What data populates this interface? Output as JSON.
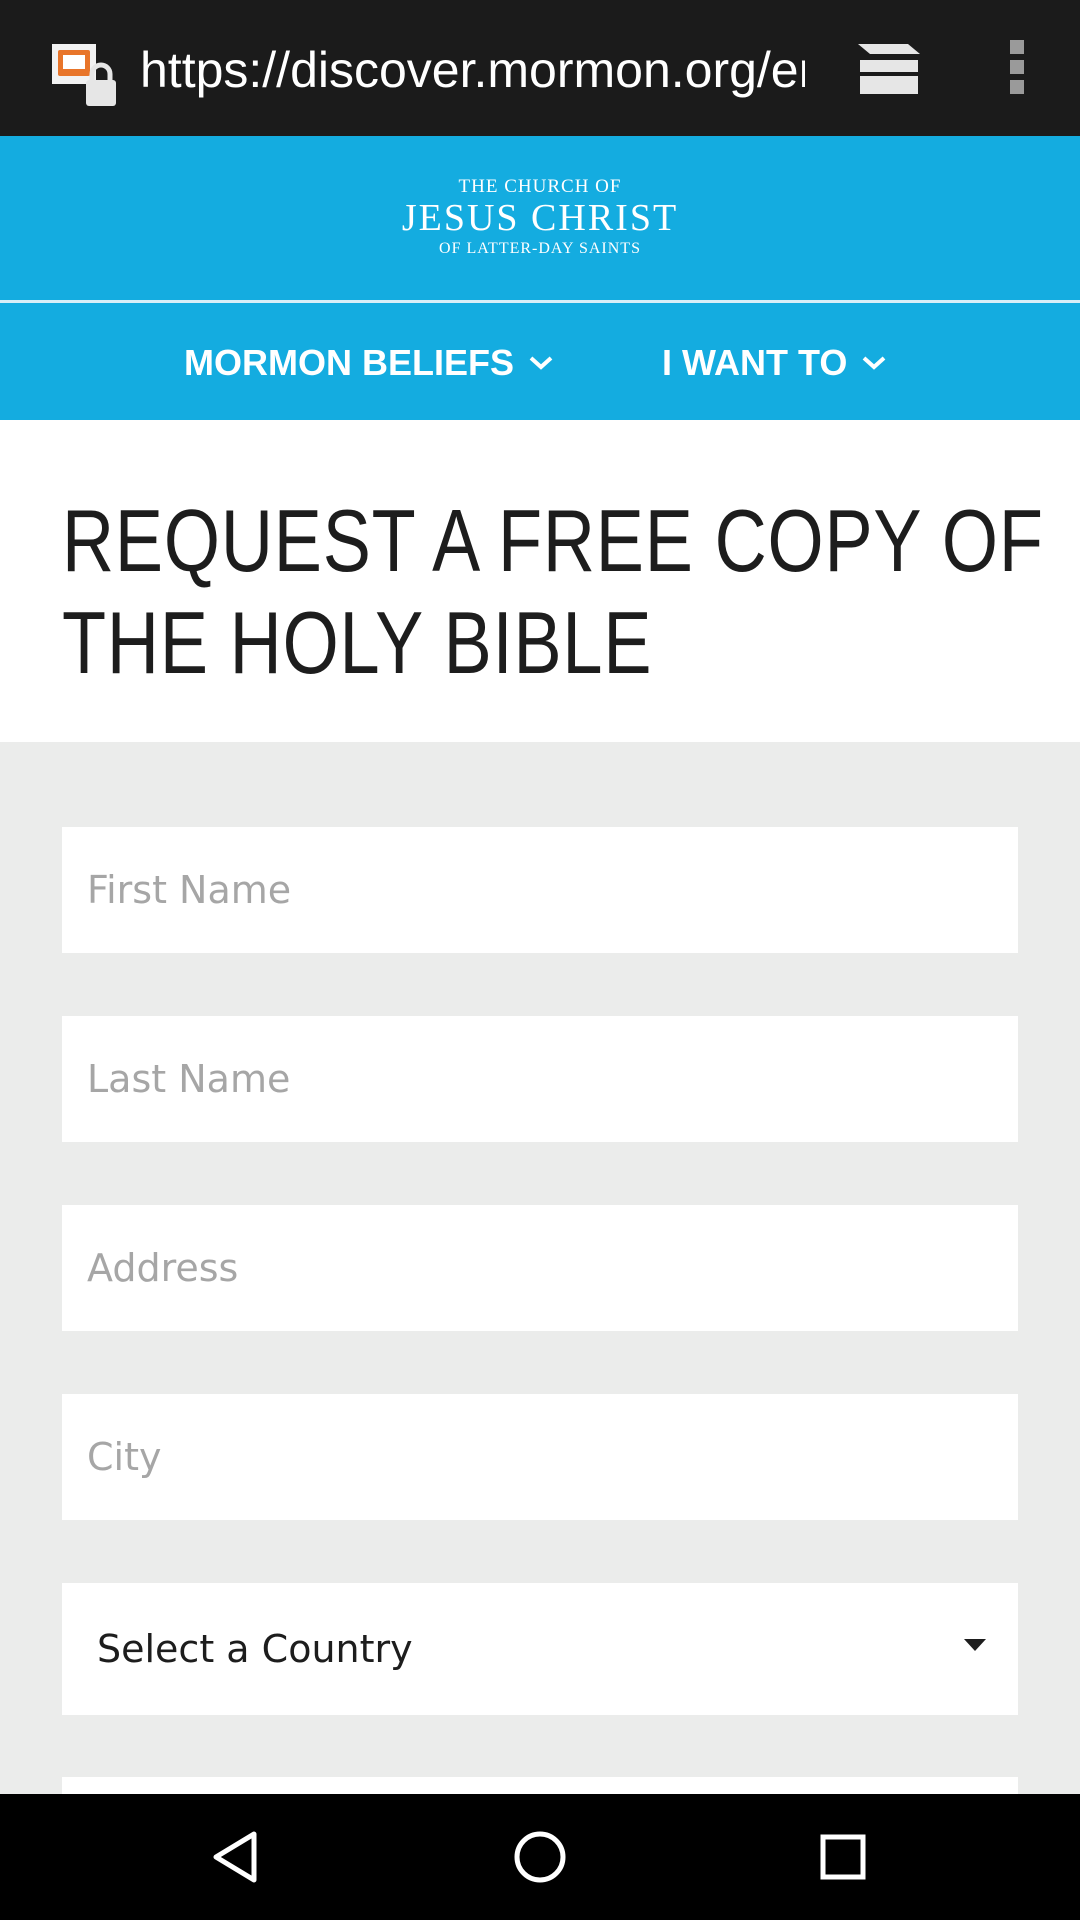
{
  "browser": {
    "url": "https://discover.mormon.org/en",
    "icons": {
      "site": "site-security-icon",
      "tabs": "tabs-switcher-icon",
      "menu": "overflow-menu-icon"
    }
  },
  "header": {
    "logo": {
      "line1": "THE CHURCH OF",
      "line2": "JESUS CHRIST",
      "line3": "OF LATTER-DAY SAINTS"
    },
    "nav": [
      {
        "label": "MORMON BELIEFS",
        "icon": "chevron-down-icon"
      },
      {
        "label": "I WANT TO",
        "icon": "chevron-down-icon"
      }
    ]
  },
  "page": {
    "title_line1": "REQUEST A FREE COPY OF",
    "title_line2": "THE HOLY BIBLE"
  },
  "form": {
    "first_name": {
      "placeholder": "First Name",
      "value": ""
    },
    "last_name": {
      "placeholder": "Last Name",
      "value": ""
    },
    "address": {
      "placeholder": "Address",
      "value": ""
    },
    "city": {
      "placeholder": "City",
      "value": ""
    },
    "country": {
      "selected": "Select a Country"
    }
  },
  "colors": {
    "brand_blue": "#14ace0",
    "form_bg": "#ebeceb",
    "chrome": "#1b1b1b"
  },
  "system_nav": [
    "back-icon",
    "home-icon",
    "recent-apps-icon"
  ]
}
